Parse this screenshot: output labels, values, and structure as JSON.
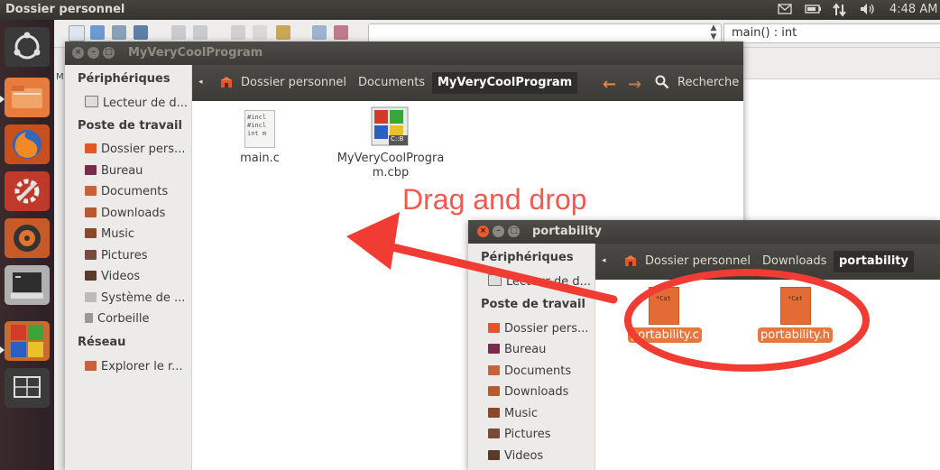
{
  "top_panel": {
    "title": "Dossier personnel",
    "clock": "4:48 AM",
    "indicators": [
      "mail-icon",
      "battery-icon",
      "network-icon",
      "volume-icon"
    ]
  },
  "launcher": {
    "items": [
      "ubuntu-logo-icon",
      "home-folder-icon",
      "firefox-icon",
      "system-settings-icon",
      "media-player-icon",
      "terminal-icon",
      "codeblocks-icon",
      "workspace-switcher-icon"
    ]
  },
  "codeblocks": {
    "function_combo": "main() : int"
  },
  "window_main": {
    "title": "MyVeryCoolProgram",
    "breadcrumbs": [
      "Dossier personnel",
      "Documents",
      "MyVeryCoolProgram"
    ],
    "search_label": "Recherche",
    "sidebar": {
      "devices_header": "Périphériques",
      "devices": [
        "Lecteur de d..."
      ],
      "computer_header": "Poste de travail",
      "places": [
        "Dossier pers...",
        "Bureau",
        "Documents",
        "Downloads",
        "Music",
        "Pictures",
        "Videos",
        "Système de ...",
        "Corbeille"
      ],
      "network_header": "Réseau",
      "network": [
        "Explorer le r..."
      ]
    },
    "files": [
      {
        "name": "main.c",
        "preview": [
          "#incl",
          "#incl",
          "",
          "int m"
        ]
      },
      {
        "name_line1": "MyVeryCoolProgra",
        "name_line2": "m.cbp",
        "badge": "C::B"
      }
    ]
  },
  "window_portability": {
    "title": "portability",
    "breadcrumbs": [
      "Dossier personnel",
      "Downloads",
      "portability"
    ],
    "sidebar": {
      "devices_header": "Périphériques",
      "devices": [
        "Lecteur de d..."
      ],
      "computer_header": "Poste de travail",
      "places": [
        "Dossier pers...",
        "Bureau",
        "Documents",
        "Downloads",
        "Music",
        "Pictures",
        "Videos"
      ]
    },
    "files": [
      {
        "name": "portability.c",
        "preview": "*Cat"
      },
      {
        "name": "portability.h",
        "preview": "*Cat"
      }
    ]
  },
  "annotation": {
    "label": "Drag and drop",
    "color": "#f03c32"
  }
}
